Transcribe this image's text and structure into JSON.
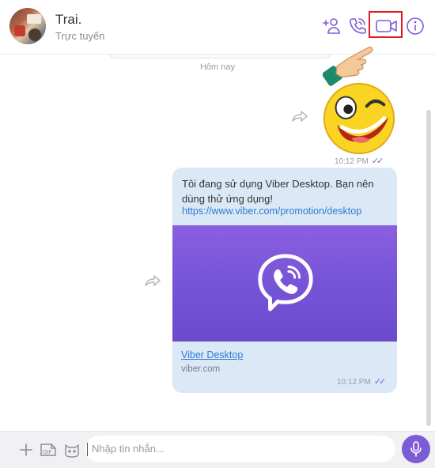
{
  "header": {
    "contact_name": "Trai.",
    "status": "Trực tuyến",
    "icons": [
      "add-contact-icon",
      "voice-call-icon",
      "video-call-icon",
      "info-icon"
    ]
  },
  "chat": {
    "date_separator": "Hôm nay",
    "messages": [
      {
        "type": "sticker",
        "sticker": "winking-smiley",
        "time": "10:12 PM",
        "ticks": "✓✓"
      },
      {
        "type": "link",
        "text": "Tôi đang sử dụng Viber Desktop. Bạn nên dùng thử ứng dụng!",
        "url": "https://www.viber.com/promotion/desktop",
        "preview_title": "Viber Desktop",
        "preview_domain": "viber.com",
        "time": "10:12 PM",
        "ticks": "✓✓"
      }
    ]
  },
  "input": {
    "placeholder": "Nhập tin nhắn...",
    "icons": [
      "plus-icon",
      "gif-icon",
      "sticker-icon",
      "microphone-icon"
    ]
  },
  "colors": {
    "accent": "#7c5cd6",
    "bubble": "#dbe9f7",
    "link": "#2f7ad0",
    "highlight": "#e11b22"
  }
}
